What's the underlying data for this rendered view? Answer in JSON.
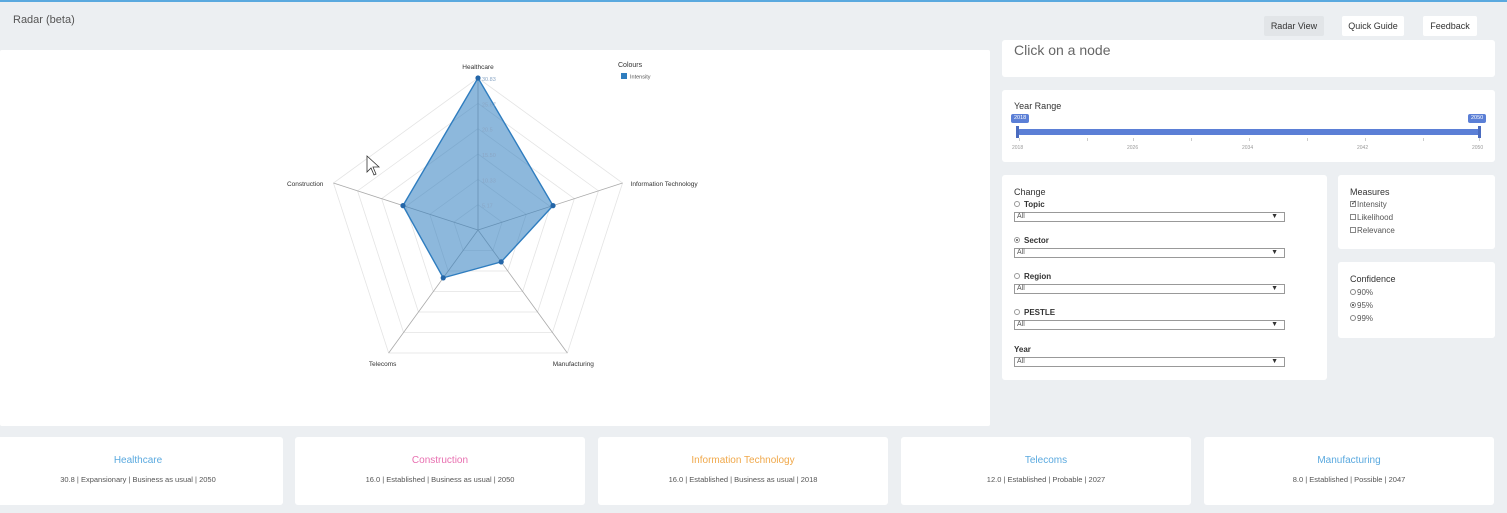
{
  "app": {
    "title": "Radar (beta)"
  },
  "toolbar": {
    "radar_view": "Radar View",
    "quick_guide": "Quick Guide",
    "feedback": "Feedback"
  },
  "chart_data": {
    "type": "radar",
    "axes": [
      "Healthcare",
      "Information Technology",
      "Manufacturing",
      "Telecoms",
      "Construction"
    ],
    "series": [
      {
        "name": "Intensity",
        "values": [
          30.83,
          16.0,
          8.0,
          12.0,
          16.0
        ],
        "color": "#2f7dbf"
      }
    ],
    "scale_labels": [
      "5.17",
      "10.33",
      "15.50",
      "20.5",
      "25.67",
      "30.83"
    ],
    "scale_max": 30.83,
    "legend": {
      "title": "Colours",
      "entries": [
        "Intensity"
      ],
      "placement": "top-right"
    }
  },
  "node_panel": {
    "message": "Click on a node"
  },
  "year_range": {
    "title": "Year Range",
    "min_label": "2018",
    "max_label": "2050",
    "ticks": [
      "2018",
      "2026",
      "2034",
      "2042",
      "2050"
    ]
  },
  "change": {
    "title": "Change",
    "groups": [
      {
        "label": "Topic",
        "selected": false,
        "value": "All"
      },
      {
        "label": "Sector",
        "selected": true,
        "value": "All"
      },
      {
        "label": "Region",
        "selected": false,
        "value": "All"
      },
      {
        "label": "PESTLE",
        "selected": false,
        "value": "All"
      }
    ],
    "year": {
      "label": "Year",
      "value": "All"
    }
  },
  "measures": {
    "title": "Measures",
    "options": [
      {
        "label": "Intensity",
        "checked": true
      },
      {
        "label": "Likelihood",
        "checked": false
      },
      {
        "label": "Relevance",
        "checked": false
      }
    ]
  },
  "confidence": {
    "title": "Confidence",
    "options": [
      {
        "label": "90%",
        "selected": false
      },
      {
        "label": "95%",
        "selected": true
      },
      {
        "label": "99%",
        "selected": false
      }
    ]
  },
  "summaries": [
    {
      "title": "Healthcare",
      "detail": "30.8 | Expansionary | Business as usual | 2050",
      "color": "#5aa9df"
    },
    {
      "title": "Construction",
      "detail": "16.0 | Established | Business as usual | 2050",
      "color": "#e86fb0"
    },
    {
      "title": "Information Technology",
      "detail": "16.0 | Established | Business as usual | 2018",
      "color": "#f0a84a"
    },
    {
      "title": "Telecoms",
      "detail": "12.0 | Established | Probable | 2027",
      "color": "#5aa9df"
    },
    {
      "title": "Manufacturing",
      "detail": "8.0 | Established | Possible | 2047",
      "color": "#5aa9df"
    }
  ]
}
